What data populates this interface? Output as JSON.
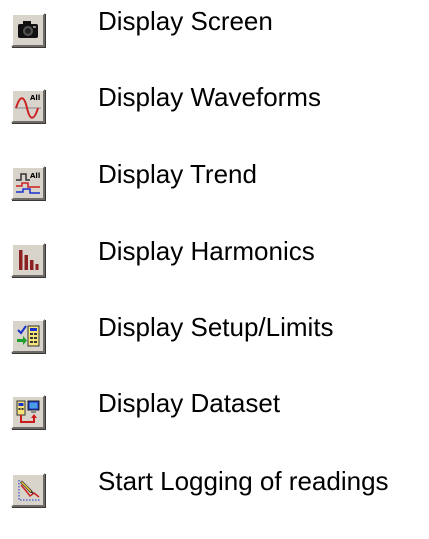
{
  "items": [
    {
      "icon": "camera-icon",
      "label": "Display Screen"
    },
    {
      "icon": "waveform-all-icon",
      "label": "Display Waveforms"
    },
    {
      "icon": "trend-all-icon",
      "label": "Display Trend"
    },
    {
      "icon": "harmonics-bars-icon",
      "label": "Display Harmonics"
    },
    {
      "icon": "setup-limits-icon",
      "label": "Display Setup/Limits"
    },
    {
      "icon": "dataset-icon",
      "label": "Display Dataset"
    },
    {
      "icon": "logging-icon",
      "label": "Start Logging of readings"
    }
  ],
  "colors": {
    "button_face": "#d8d4cc",
    "harmonics_red": "#8b2020",
    "wave_red": "#cc2222",
    "trend_blue": "#1a2fcc",
    "setup_green": "#1fa02a",
    "dataset_red": "#cc1b1b"
  }
}
